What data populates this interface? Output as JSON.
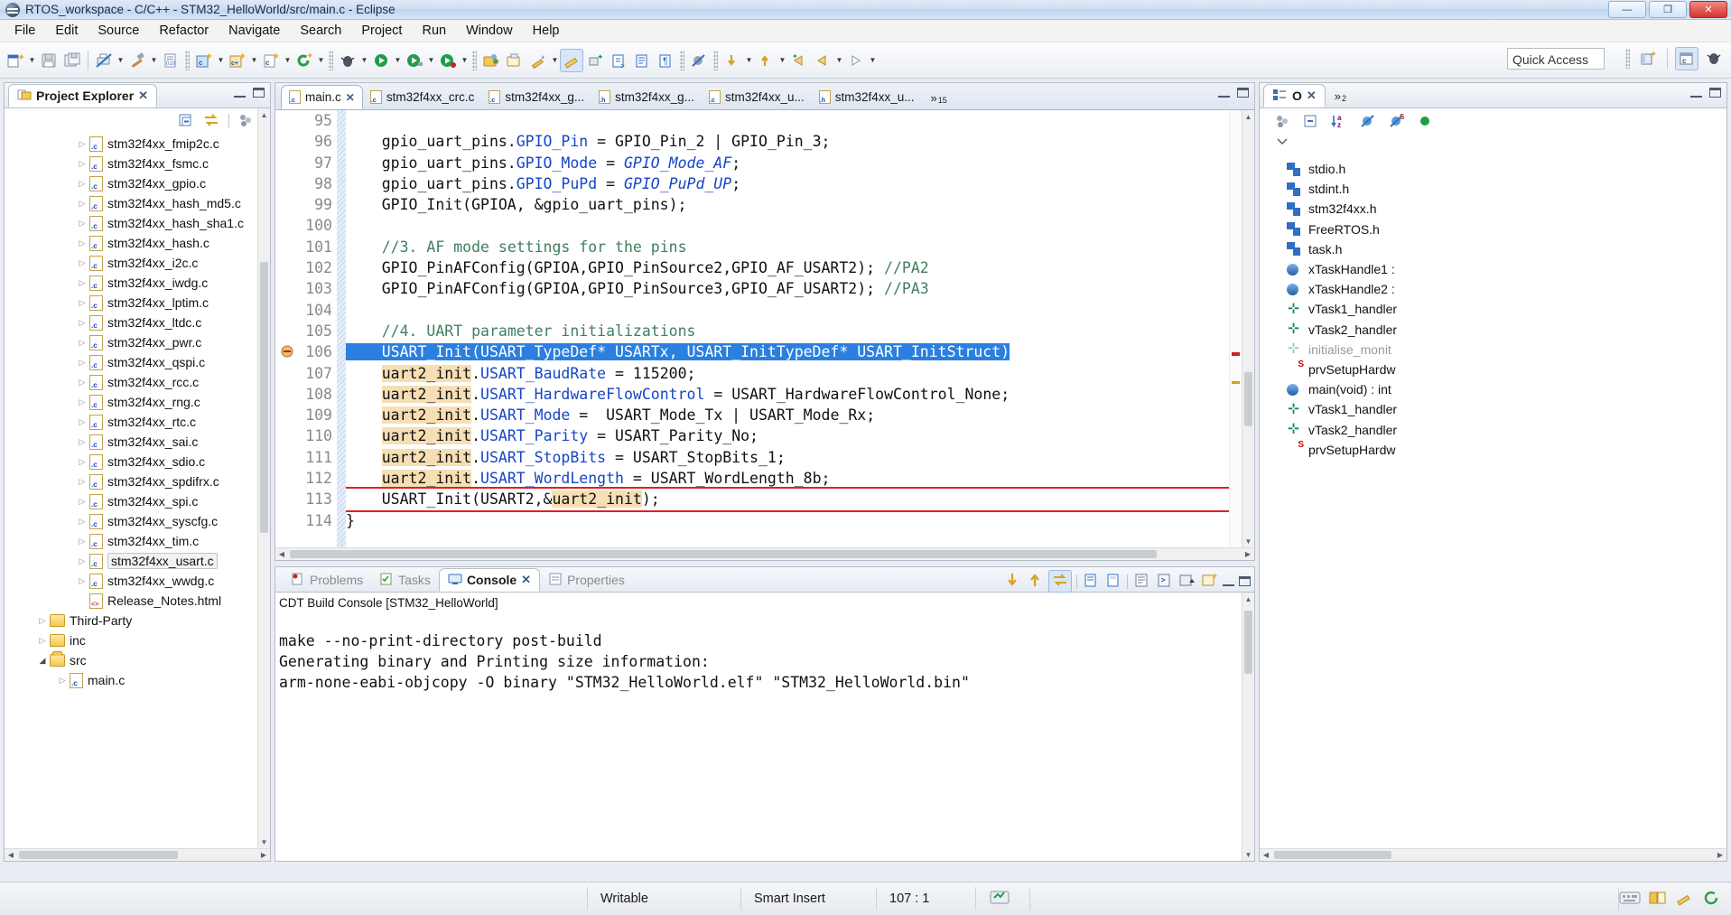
{
  "window": {
    "title": "RTOS_workspace - C/C++ - STM32_HelloWorld/src/main.c - Eclipse",
    "icon": "eclipse-icon",
    "minimize_label": "—",
    "maximize_label": "❐",
    "close_label": "✕"
  },
  "menubar": [
    {
      "label": "File"
    },
    {
      "label": "Edit"
    },
    {
      "label": "Source"
    },
    {
      "label": "Refactor"
    },
    {
      "label": "Navigate"
    },
    {
      "label": "Search"
    },
    {
      "label": "Project"
    },
    {
      "label": "Run"
    },
    {
      "label": "Window"
    },
    {
      "label": "Help"
    }
  ],
  "toolbar": {
    "quick_access_placeholder": "Quick Access",
    "buttons": [
      {
        "name": "new-wizard-icon"
      },
      {
        "name": "save-icon"
      },
      {
        "name": "save-all-icon"
      },
      {
        "name": "print-disabled-icon"
      },
      {
        "name": "build-hammer-icon"
      },
      {
        "name": "binary-file-icon"
      },
      {
        "name": "new-c-project-icon"
      },
      {
        "name": "new-cpp-project-icon"
      },
      {
        "name": "new-c-file-icon"
      },
      {
        "name": "refresh-icon"
      },
      {
        "name": "debug-bug-icon"
      },
      {
        "name": "run-icon"
      },
      {
        "name": "run-external-icon"
      },
      {
        "name": "run-config-icon"
      },
      {
        "name": "open-type-icon"
      },
      {
        "name": "open-resource-icon"
      },
      {
        "name": "pencil-edit-icon"
      },
      {
        "name": "marker-highlight-icon"
      },
      {
        "name": "toggle-mark-occurrences-icon"
      },
      {
        "name": "next-edit-icon"
      },
      {
        "name": "show-whitespace-icon"
      },
      {
        "name": "block-selection-icon"
      },
      {
        "name": "skip-breakpoints-icon"
      },
      {
        "name": "next-annotation-icon"
      },
      {
        "name": "previous-annotation-icon"
      },
      {
        "name": "back-icon"
      },
      {
        "name": "forward-icon"
      }
    ],
    "perspective_buttons": [
      {
        "name": "open-perspective-icon"
      },
      {
        "name": "cpp-perspective-icon"
      },
      {
        "name": "debug-perspective-icon"
      }
    ]
  },
  "project_explorer": {
    "tab_label": "Project Explorer",
    "tab_close": "✕",
    "toolbar_icons": [
      "collapse-all-icon",
      "link-with-editor-icon",
      "view-menu-icon",
      "minimize-icon",
      "maximize-icon"
    ],
    "tree": [
      {
        "label": "stm32f4xx_fmip2c.c",
        "type": "file",
        "indent": 3,
        "expandable": true
      },
      {
        "label": "stm32f4xx_fsmc.c",
        "type": "file",
        "indent": 3,
        "expandable": true
      },
      {
        "label": "stm32f4xx_gpio.c",
        "type": "file",
        "indent": 3,
        "expandable": true
      },
      {
        "label": "stm32f4xx_hash_md5.c",
        "type": "file",
        "indent": 3,
        "expandable": true
      },
      {
        "label": "stm32f4xx_hash_sha1.c",
        "type": "file",
        "indent": 3,
        "expandable": true
      },
      {
        "label": "stm32f4xx_hash.c",
        "type": "file",
        "indent": 3,
        "expandable": true
      },
      {
        "label": "stm32f4xx_i2c.c",
        "type": "file",
        "indent": 3,
        "expandable": true
      },
      {
        "label": "stm32f4xx_iwdg.c",
        "type": "file",
        "indent": 3,
        "expandable": true
      },
      {
        "label": "stm32f4xx_lptim.c",
        "type": "file",
        "indent": 3,
        "expandable": true
      },
      {
        "label": "stm32f4xx_ltdc.c",
        "type": "file",
        "indent": 3,
        "expandable": true
      },
      {
        "label": "stm32f4xx_pwr.c",
        "type": "file",
        "indent": 3,
        "expandable": true
      },
      {
        "label": "stm32f4xx_qspi.c",
        "type": "file",
        "indent": 3,
        "expandable": true
      },
      {
        "label": "stm32f4xx_rcc.c",
        "type": "file",
        "indent": 3,
        "expandable": true
      },
      {
        "label": "stm32f4xx_rng.c",
        "type": "file",
        "indent": 3,
        "expandable": true
      },
      {
        "label": "stm32f4xx_rtc.c",
        "type": "file",
        "indent": 3,
        "expandable": true
      },
      {
        "label": "stm32f4xx_sai.c",
        "type": "file",
        "indent": 3,
        "expandable": true
      },
      {
        "label": "stm32f4xx_sdio.c",
        "type": "file",
        "indent": 3,
        "expandable": true
      },
      {
        "label": "stm32f4xx_spdifrx.c",
        "type": "file",
        "indent": 3,
        "expandable": true
      },
      {
        "label": "stm32f4xx_spi.c",
        "type": "file",
        "indent": 3,
        "expandable": true
      },
      {
        "label": "stm32f4xx_syscfg.c",
        "type": "file",
        "indent": 3,
        "expandable": true
      },
      {
        "label": "stm32f4xx_tim.c",
        "type": "file",
        "indent": 3,
        "expandable": true
      },
      {
        "label": "stm32f4xx_usart.c",
        "type": "file",
        "indent": 3,
        "expandable": true,
        "selected": true
      },
      {
        "label": "stm32f4xx_wwdg.c",
        "type": "file",
        "indent": 3,
        "expandable": true
      },
      {
        "label": "Release_Notes.html",
        "type": "html",
        "indent": 3,
        "expandable": false
      },
      {
        "label": "Third-Party",
        "type": "folder",
        "indent": 1,
        "expandable": true
      },
      {
        "label": "inc",
        "type": "folder",
        "indent": 1,
        "expandable": true
      },
      {
        "label": "src",
        "type": "folder-open",
        "indent": 1,
        "expandable": true,
        "expanded": true
      },
      {
        "label": "main.c",
        "type": "file",
        "indent": 2,
        "expandable": true
      }
    ]
  },
  "editor": {
    "tabs": [
      {
        "label": "main.c",
        "kind": "c",
        "active": true,
        "close": "✕"
      },
      {
        "label": "stm32f4xx_crc.c",
        "kind": "c",
        "active": false
      },
      {
        "label": "stm32f4xx_g...",
        "kind": "c",
        "active": false
      },
      {
        "label": "stm32f4xx_g...",
        "kind": "h",
        "active": false
      },
      {
        "label": "stm32f4xx_u...",
        "kind": "c",
        "active": false
      },
      {
        "label": "stm32f4xx_u...",
        "kind": "h",
        "active": false
      }
    ],
    "more_tabs_count": "15",
    "more_tabs_symbol": "»",
    "minimize_label": "—",
    "maximize_label": "❐",
    "first_visible_line": 95,
    "lines": [
      {
        "n": 95,
        "text": ""
      },
      {
        "n": 96,
        "text": "    gpio_uart_pins.GPIO_Pin = GPIO_Pin_2 | GPIO_Pin_3;"
      },
      {
        "n": 97,
        "text": "    gpio_uart_pins.GPIO_Mode = GPIO_Mode_AF;"
      },
      {
        "n": 98,
        "text": "    gpio_uart_pins.GPIO_PuPd = GPIO_PuPd_UP;"
      },
      {
        "n": 99,
        "text": "    GPIO_Init(GPIOA, &gpio_uart_pins);"
      },
      {
        "n": 100,
        "text": ""
      },
      {
        "n": 101,
        "text": "    //3. AF mode settings for the pins"
      },
      {
        "n": 102,
        "text": "    GPIO_PinAFConfig(GPIOA,GPIO_PinSource2,GPIO_AF_USART2); //PA2"
      },
      {
        "n": 103,
        "text": "    GPIO_PinAFConfig(GPIOA,GPIO_PinSource3,GPIO_AF_USART2); //PA3"
      },
      {
        "n": 104,
        "text": ""
      },
      {
        "n": 105,
        "text": "    //4. UART parameter initializations"
      },
      {
        "n": 106,
        "text": "    USART_Init(USART_TypeDef* USARTx, USART_InitTypeDef* USART_InitStruct)"
      },
      {
        "n": 107,
        "text": "    uart2_init.USART_BaudRate = 115200;"
      },
      {
        "n": 108,
        "text": "    uart2_init.USART_HardwareFlowControl = USART_HardwareFlowControl_None;"
      },
      {
        "n": 109,
        "text": "    uart2_init.USART_Mode =  USART_Mode_Tx | USART_Mode_Rx;"
      },
      {
        "n": 110,
        "text": "    uart2_init.USART_Parity = USART_Parity_No;"
      },
      {
        "n": 111,
        "text": "    uart2_init.USART_StopBits = USART_StopBits_1;"
      },
      {
        "n": 112,
        "text": "    uart2_init.USART_WordLength = USART_WordLength_8b;"
      },
      {
        "n": 113,
        "text": "    USART_Init(USART2,&uart2_init);"
      },
      {
        "n": 114,
        "text": "}"
      }
    ],
    "selected_line": 106,
    "error_line": 113,
    "error_marker_line": 106
  },
  "console": {
    "tabs": [
      {
        "label": "Problems",
        "icon": "problems-icon",
        "active": false
      },
      {
        "label": "Tasks",
        "icon": "tasks-icon",
        "active": false
      },
      {
        "label": "Console",
        "icon": "console-icon",
        "active": true,
        "close": "✕"
      },
      {
        "label": "Properties",
        "icon": "properties-icon",
        "active": false
      }
    ],
    "title": "CDT Build Console [STM32_HelloWorld]",
    "lines": [
      "make --no-print-directory post-build",
      "Generating binary and Printing size information:",
      "arm-none-eabi-objcopy -O binary \"STM32_HelloWorld.elf\" \"STM32_HelloWorld.bin\""
    ],
    "toolbar_icons": [
      "scroll-down-icon",
      "scroll-up-icon",
      "scroll-lock-icon",
      "clear-console-icon",
      "pin-console-icon",
      "display-console-icon",
      "open-console-icon",
      "new-console-icon",
      "console-menu-icon",
      "minimize-icon",
      "maximize-icon"
    ]
  },
  "outline": {
    "tab_label": "O",
    "tab_close": "✕",
    "more_tabs_symbol": "»",
    "more_tabs_count": "2",
    "minimize_label": "—",
    "maximize_label": "❐",
    "toolbar_icons": [
      "focus-active-task-icon",
      "collapse-all-icon",
      "sort-az-icon",
      "hide-fields-icon",
      "hide-static-icon",
      "hide-nonpublic-icon",
      "view-menu-icon"
    ],
    "items": [
      {
        "label": "stdio.h",
        "kind": "header"
      },
      {
        "label": "stdint.h",
        "kind": "header"
      },
      {
        "label": "stm32f4xx.h",
        "kind": "header"
      },
      {
        "label": "FreeRTOS.h",
        "kind": "header"
      },
      {
        "label": "task.h",
        "kind": "header"
      },
      {
        "label": "xTaskHandle1 :",
        "kind": "variable"
      },
      {
        "label": "xTaskHandle2 :",
        "kind": "variable"
      },
      {
        "label": "vTask1_handler",
        "kind": "function"
      },
      {
        "label": "vTask2_handler",
        "kind": "function"
      },
      {
        "label": "initialise_monit",
        "kind": "function-dim"
      },
      {
        "label": "prvSetupHardw",
        "kind": "function-static"
      },
      {
        "label": "main(void) : int",
        "kind": "variable"
      },
      {
        "label": "vTask1_handler",
        "kind": "function"
      },
      {
        "label": "vTask2_handler",
        "kind": "function"
      },
      {
        "label": "prvSetupHardw",
        "kind": "function-static-alt"
      }
    ]
  },
  "statusbar": {
    "writable": "Writable",
    "insert_mode": "Smart Insert",
    "cursor_position": "107 : 1",
    "icons": [
      "build-status-icon",
      "keyboard-icon",
      "book-icon",
      "pencil-icon",
      "sync-icon"
    ]
  }
}
